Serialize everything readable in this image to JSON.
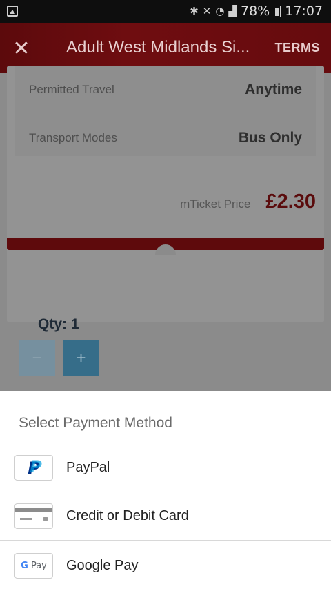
{
  "status_bar": {
    "battery": "78%",
    "time": "17:07",
    "icons": [
      "bluetooth-icon",
      "mute-icon",
      "wifi-icon",
      "signal-icon",
      "battery-icon"
    ]
  },
  "app_bar": {
    "close_icon": "close-icon",
    "title": "Adult West Midlands Si...",
    "terms_label": "TERMS"
  },
  "ticket": {
    "details": [
      {
        "label": "Permitted Travel",
        "value": "Anytime"
      },
      {
        "label": "Transport Modes",
        "value": "Bus Only"
      }
    ],
    "price_label": "mTicket Price",
    "price_value": "£2.30"
  },
  "quantity": {
    "label": "Qty: 1",
    "minus": "−",
    "plus": "+"
  },
  "payment_sheet": {
    "title": "Select Payment Method",
    "methods": [
      {
        "label": "PayPal",
        "icon": "paypal-icon"
      },
      {
        "label": "Credit or Debit Card",
        "icon": "card-icon"
      },
      {
        "label": "Google Pay",
        "icon": "google-pay-icon",
        "icon_text_g": "G",
        "icon_text": "Pay"
      }
    ]
  },
  "colors": {
    "brand_red": "#6f0d10",
    "price_red": "#5a0b0c",
    "qty_button": "#366d89"
  }
}
